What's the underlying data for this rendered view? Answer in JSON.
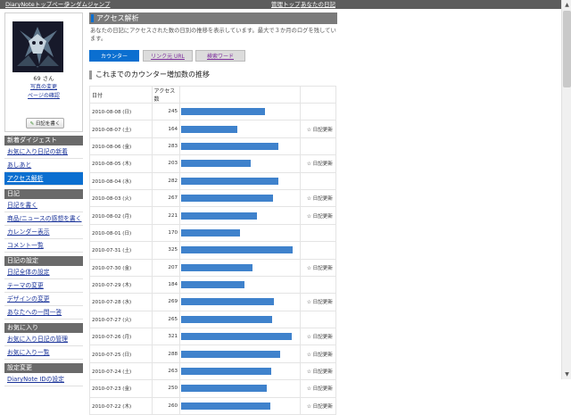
{
  "topbar": {
    "links": [
      {
        "label": "DiaryNoteトップページ"
      },
      {
        "label": "ランダムジャンプ"
      },
      {
        "label": "管理トップ"
      },
      {
        "label": "あなたの日記"
      }
    ]
  },
  "sidebar": {
    "profile": {
      "nickname": "69 さん",
      "photo_link": "写真の変更",
      "page_confirm_link": "ページの確認",
      "write_button": "日記を書く"
    },
    "sections": [
      {
        "title": "新着ダイジェスト",
        "items": [
          {
            "label": "お気に入り日記の新着",
            "active": false
          },
          {
            "label": "あしあと",
            "active": false
          },
          {
            "label": "アクセス解析",
            "active": true
          }
        ]
      },
      {
        "title": "日記",
        "items": [
          {
            "label": "日記を書く",
            "active": false
          },
          {
            "label": "商品/ニュースの感想を書く",
            "active": false
          },
          {
            "label": "カレンダー表示",
            "active": false
          },
          {
            "label": "コメント一覧",
            "active": false
          }
        ]
      },
      {
        "title": "日記の設定",
        "items": [
          {
            "label": "日記全体の設定",
            "active": false
          },
          {
            "label": "テーマの変更",
            "active": false
          },
          {
            "label": "デザインの変更",
            "active": false
          },
          {
            "label": "あなたへの一問一答",
            "active": false
          }
        ]
      },
      {
        "title": "お気に入り",
        "items": [
          {
            "label": "お気に入り日記の管理",
            "active": false
          },
          {
            "label": "お気に入り一覧",
            "active": false
          }
        ]
      },
      {
        "title": "設定変更",
        "items": [
          {
            "label": "DiaryNote IDの設定",
            "active": false
          }
        ]
      }
    ]
  },
  "main": {
    "title": "アクセス解析",
    "description": "あなたの日記にアクセスされた数の日別の推移を表示しています。最大で３か月のログを残しています。",
    "tabs": [
      {
        "label": "カウンター",
        "active": true
      },
      {
        "label": "リンク元 URL",
        "active": false
      },
      {
        "label": "検索ワード",
        "active": false
      }
    ],
    "subheading": "これまでのカウンター増加数の推移",
    "table": {
      "headers": [
        "日付",
        "アクセス数",
        "",
        ""
      ],
      "max_value": 325,
      "note_icon": "☆",
      "rows": [
        {
          "date": "2010-08-08 (日)",
          "count": 245,
          "note": ""
        },
        {
          "date": "2010-08-07 (土)",
          "count": 164,
          "note": "日記更新"
        },
        {
          "date": "2010-08-06 (金)",
          "count": 283,
          "note": ""
        },
        {
          "date": "2010-08-05 (木)",
          "count": 203,
          "note": "日記更新"
        },
        {
          "date": "2010-08-04 (水)",
          "count": 282,
          "note": ""
        },
        {
          "date": "2010-08-03 (火)",
          "count": 267,
          "note": "日記更新"
        },
        {
          "date": "2010-08-02 (月)",
          "count": 221,
          "note": "日記更新"
        },
        {
          "date": "2010-08-01 (日)",
          "count": 170,
          "note": ""
        },
        {
          "date": "2010-07-31 (土)",
          "count": 325,
          "note": ""
        },
        {
          "date": "2010-07-30 (金)",
          "count": 207,
          "note": "日記更新"
        },
        {
          "date": "2010-07-29 (木)",
          "count": 184,
          "note": ""
        },
        {
          "date": "2010-07-28 (水)",
          "count": 269,
          "note": "日記更新"
        },
        {
          "date": "2010-07-27 (火)",
          "count": 265,
          "note": ""
        },
        {
          "date": "2010-07-26 (月)",
          "count": 321,
          "note": "日記更新"
        },
        {
          "date": "2010-07-25 (日)",
          "count": 288,
          "note": "日記更新"
        },
        {
          "date": "2010-07-24 (土)",
          "count": 263,
          "note": "日記更新"
        },
        {
          "date": "2010-07-23 (金)",
          "count": 250,
          "note": "日記更新"
        },
        {
          "date": "2010-07-22 (木)",
          "count": 260,
          "note": "日記更新"
        }
      ]
    }
  },
  "colors": {
    "accent": "#0b6fd0",
    "bar": "#3f82cc",
    "header_gray": "#6a6a6a"
  },
  "icons": {
    "write_button": "pencil-icon",
    "note": "star-icon",
    "scroll_up": "arrow-up-icon",
    "scroll_down": "arrow-down-icon"
  }
}
